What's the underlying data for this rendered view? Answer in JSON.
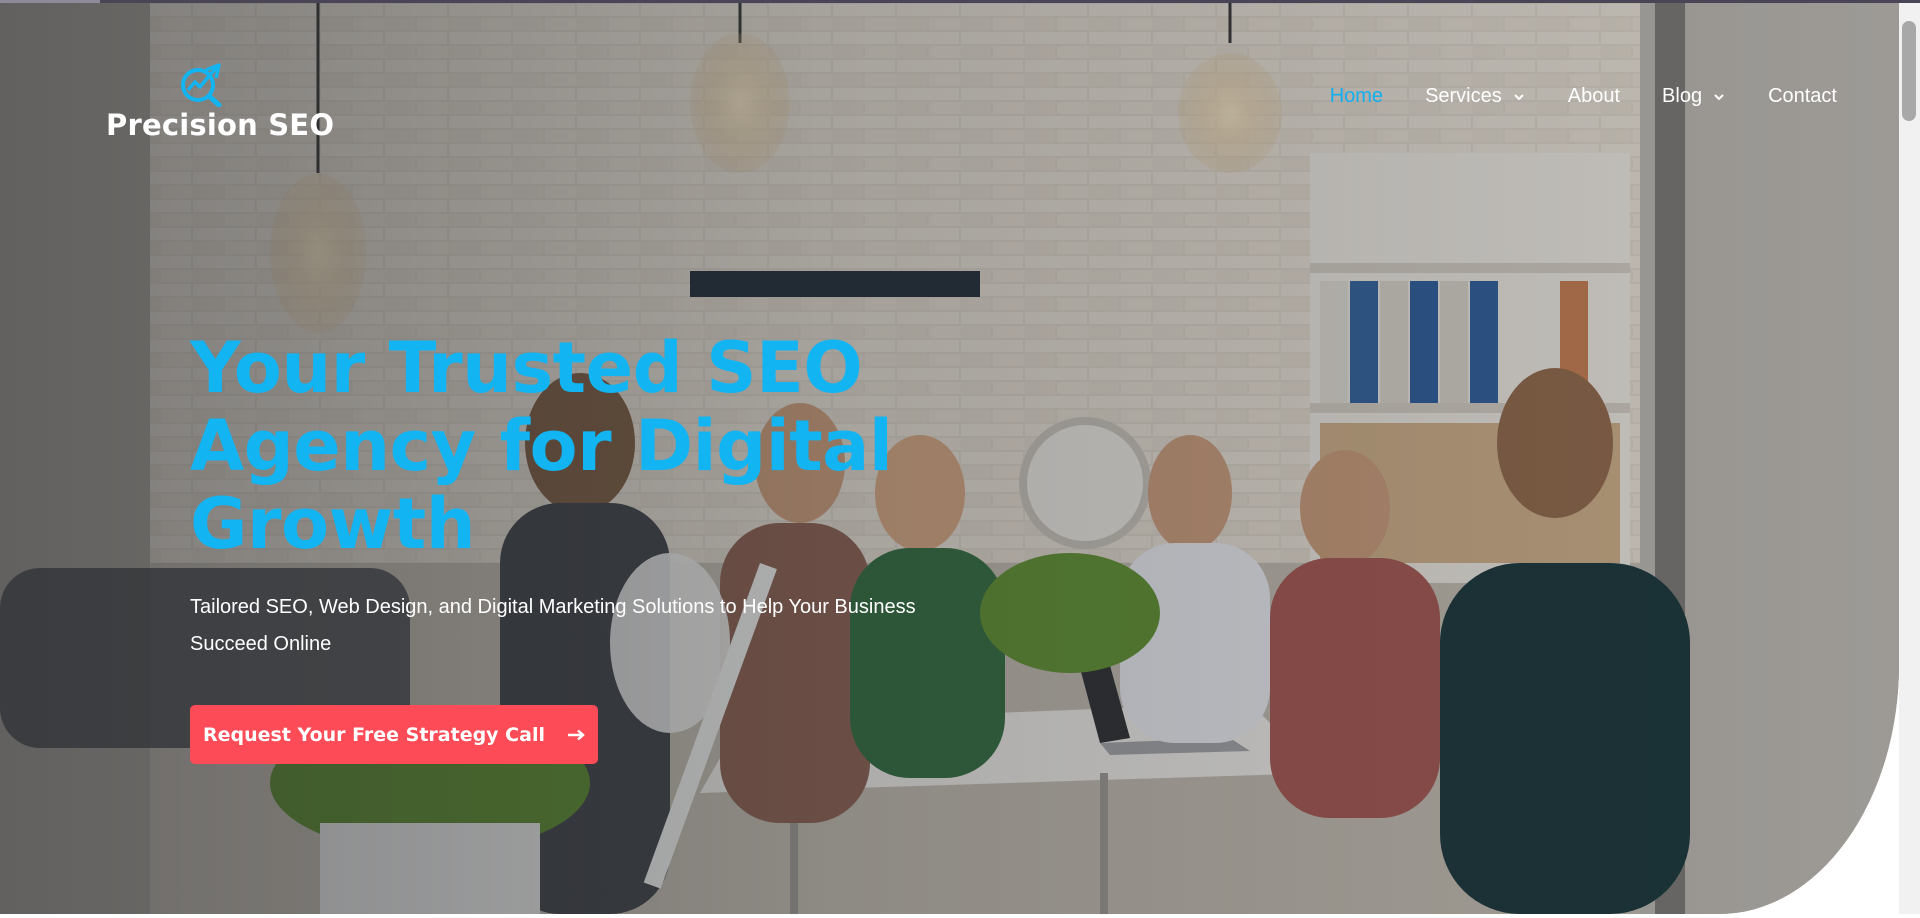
{
  "brand": {
    "name": "Precision SEO",
    "icon": "chart-growth-search-icon",
    "accent": "#12b4f2"
  },
  "nav": {
    "items": [
      {
        "label": "Home",
        "active": true
      },
      {
        "label": "Services",
        "dropdown": true
      },
      {
        "label": "About"
      },
      {
        "label": "Blog",
        "dropdown": true
      },
      {
        "label": "Contact"
      }
    ]
  },
  "hero": {
    "headline": [
      "Your Trusted SEO",
      "Agency for Digital",
      "Growth"
    ],
    "subtitle": "Tailored SEO, Web Design, and Digital Marketing Solutions to Help Your Business Succeed Online",
    "cta_label": "Request Your Free Strategy Call",
    "cta_icon": "arrow-right-icon",
    "cta_color": "#fd4c57",
    "headline_color": "#12b4f2"
  }
}
